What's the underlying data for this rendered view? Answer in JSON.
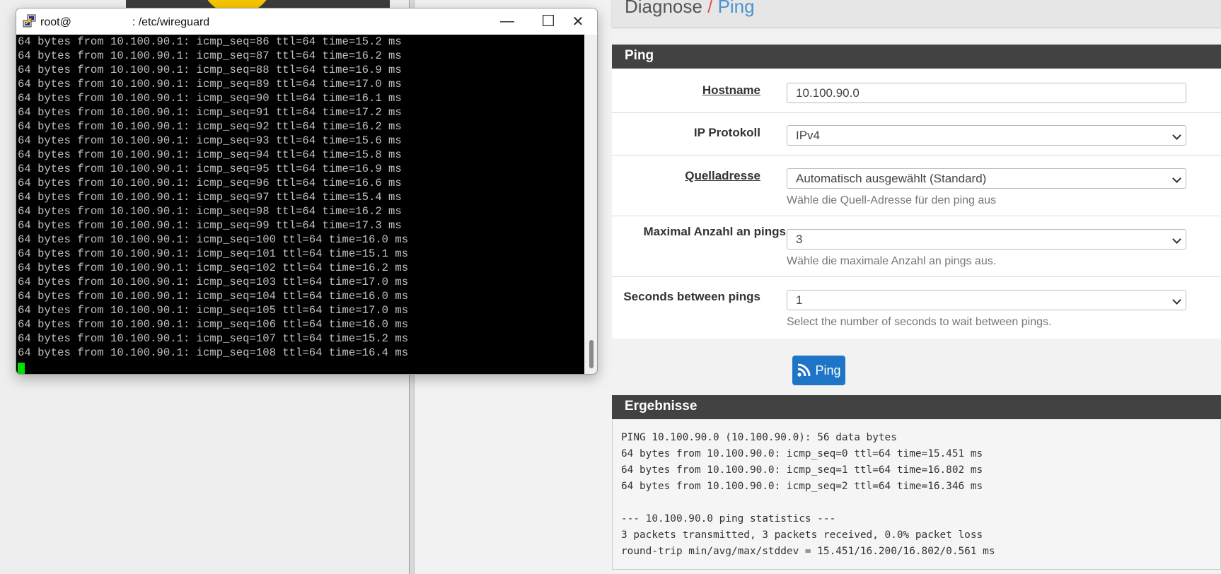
{
  "terminal": {
    "title_prefix": "root@",
    "title_suffix": ": /etc/wireguard",
    "lines": [
      "64 bytes from 10.100.90.1: icmp_seq=86 ttl=64 time=15.2 ms",
      "64 bytes from 10.100.90.1: icmp_seq=87 ttl=64 time=16.2 ms",
      "64 bytes from 10.100.90.1: icmp_seq=88 ttl=64 time=16.9 ms",
      "64 bytes from 10.100.90.1: icmp_seq=89 ttl=64 time=17.0 ms",
      "64 bytes from 10.100.90.1: icmp_seq=90 ttl=64 time=16.1 ms",
      "64 bytes from 10.100.90.1: icmp_seq=91 ttl=64 time=17.2 ms",
      "64 bytes from 10.100.90.1: icmp_seq=92 ttl=64 time=16.2 ms",
      "64 bytes from 10.100.90.1: icmp_seq=93 ttl=64 time=15.6 ms",
      "64 bytes from 10.100.90.1: icmp_seq=94 ttl=64 time=15.8 ms",
      "64 bytes from 10.100.90.1: icmp_seq=95 ttl=64 time=16.9 ms",
      "64 bytes from 10.100.90.1: icmp_seq=96 ttl=64 time=16.6 ms",
      "64 bytes from 10.100.90.1: icmp_seq=97 ttl=64 time=15.4 ms",
      "64 bytes from 10.100.90.1: icmp_seq=98 ttl=64 time=16.2 ms",
      "64 bytes from 10.100.90.1: icmp_seq=99 ttl=64 time=17.3 ms",
      "64 bytes from 10.100.90.1: icmp_seq=100 ttl=64 time=16.0 ms",
      "64 bytes from 10.100.90.1: icmp_seq=101 ttl=64 time=15.1 ms",
      "64 bytes from 10.100.90.1: icmp_seq=102 ttl=64 time=16.2 ms",
      "64 bytes from 10.100.90.1: icmp_seq=103 ttl=64 time=17.0 ms",
      "64 bytes from 10.100.90.1: icmp_seq=104 ttl=64 time=16.0 ms",
      "64 bytes from 10.100.90.1: icmp_seq=105 ttl=64 time=17.0 ms",
      "64 bytes from 10.100.90.1: icmp_seq=106 ttl=64 time=16.0 ms",
      "64 bytes from 10.100.90.1: icmp_seq=107 ttl=64 time=15.2 ms",
      "64 bytes from 10.100.90.1: icmp_seq=108 ttl=64 time=16.4 ms"
    ],
    "icon": "putty-icon",
    "window_buttons": {
      "minimize": "—",
      "maximize": "☐",
      "close": "✕"
    }
  },
  "web": {
    "breadcrumb": {
      "section": "Diagnose",
      "separator": "/",
      "current": "Ping"
    },
    "form": {
      "heading": "Ping",
      "hostname_label": "Hostname",
      "hostname_value": "10.100.90.0",
      "protocol_label": "IP Protokoll",
      "protocol_value": "IPv4",
      "source_label": "Quelladresse",
      "source_value": "Automatisch ausgewählt (Standard)",
      "source_help": "Wähle die Quell-Adresse für den ping aus",
      "count_label": "Maximal Anzahl an pings",
      "count_value": "3",
      "count_help": "Wähle die maximale Anzahl an pings aus.",
      "interval_label": "Seconds between pings",
      "interval_value": "1",
      "interval_help": "Select the number of seconds to wait between pings."
    },
    "ping_button": "Ping",
    "results": {
      "heading": "Ergebnisse",
      "output": "PING 10.100.90.0 (10.100.90.0): 56 data bytes\n64 bytes from 10.100.90.0: icmp_seq=0 ttl=64 time=15.451 ms\n64 bytes from 10.100.90.0: icmp_seq=1 ttl=64 time=16.802 ms\n64 bytes from 10.100.90.0: icmp_seq=2 ttl=64 time=16.346 ms\n\n--- 10.100.90.0 ping statistics ---\n3 packets transmitted, 3 packets received, 0.0% packet loss\nround-trip min/avg/max/stddev = 15.451/16.200/16.802/0.561 ms"
    }
  },
  "colors": {
    "panel_header": "#424242",
    "primary_button": "#1e75c7",
    "breadcrumb_separator": "#d9534f",
    "breadcrumb_current": "#4b93d2",
    "terminal_bg": "#000000",
    "terminal_text": "#c0c0c0",
    "cursor": "#00e000"
  }
}
